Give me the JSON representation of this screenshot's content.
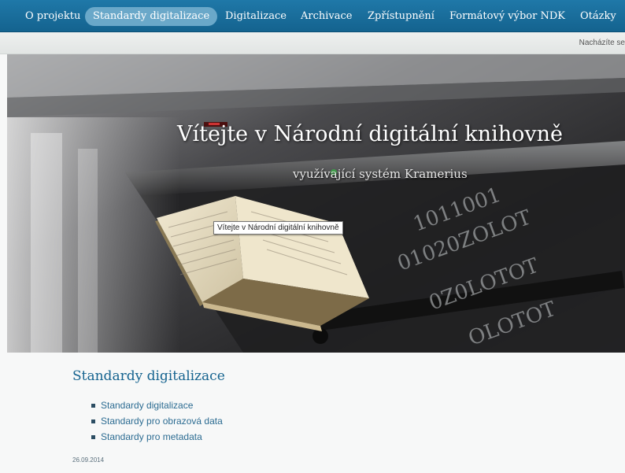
{
  "nav": {
    "items": [
      {
        "label": "O projektu"
      },
      {
        "label": "Standardy digitalizace",
        "active": true
      },
      {
        "label": "Digitalizace"
      },
      {
        "label": "Archivace"
      },
      {
        "label": "Zpřístupnění"
      },
      {
        "label": "Formátový výbor NDK"
      },
      {
        "label": "Otázky"
      }
    ]
  },
  "breadcrumb": {
    "text": "Nacházíte se"
  },
  "hero": {
    "title": "Vítejte v Národní digitální knihovně",
    "subtitle": "využívající systém Kramerius",
    "tooltip": "Vítejte v Národní digitální knihovně"
  },
  "content": {
    "title": "Standardy digitalizace",
    "links": [
      {
        "label": "Standardy digitalizace"
      },
      {
        "label": "Standardy pro obrazová data"
      },
      {
        "label": "Standardy pro metadata"
      }
    ],
    "date": "26.09.2014"
  },
  "colors": {
    "nav_bg": "#1a6f9d",
    "nav_active": "#6aa8c9",
    "title": "#15638f",
    "link": "#2c6c92"
  }
}
